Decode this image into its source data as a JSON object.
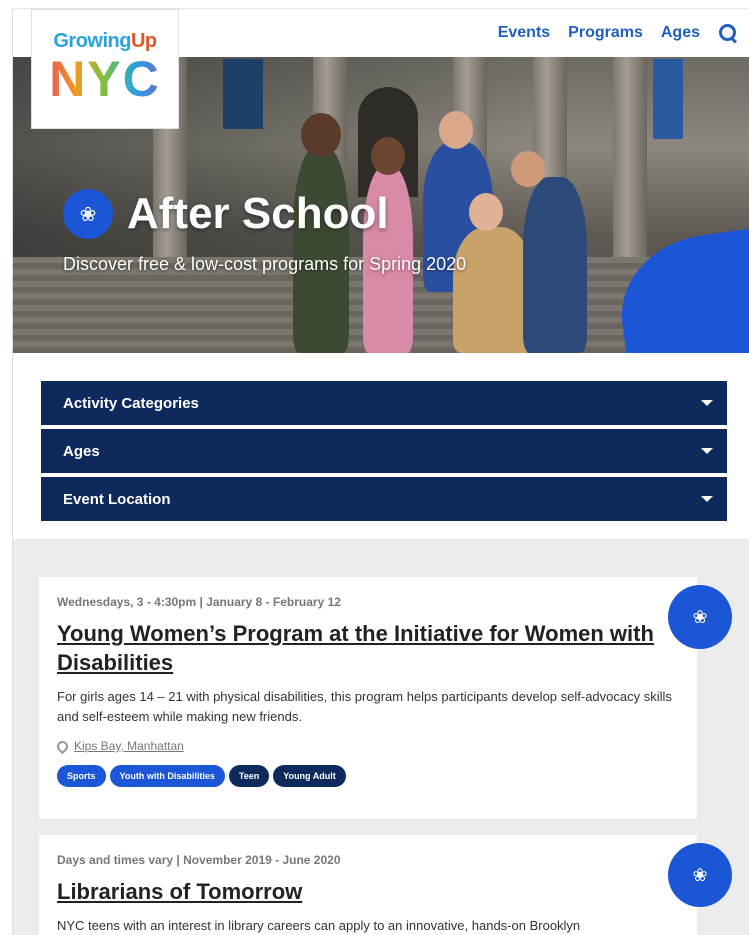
{
  "nav": {
    "events": "Events",
    "programs": "Programs",
    "ages": "Ages",
    "search_icon": "search-icon"
  },
  "logo": {
    "line1_a": "Growing",
    "line1_b": "Up",
    "line2": "NYC"
  },
  "hero": {
    "title": "After School",
    "subtitle": "Discover free & low-cost programs for Spring 2020",
    "icon": "activity-icon"
  },
  "filters": [
    "Activity Categories",
    "Ages",
    "Event Location"
  ],
  "programs": [
    {
      "meta": "Wednesdays, 3 - 4:30pm | January 8 - February 12",
      "title": "Young Women’s Program at the Initiative for Women with Disabilities",
      "desc": "For girls ages 14 – 21 with physical disabilities, this program helps participants develop self-advocacy skills and self-esteem while making new friends.",
      "location": "Kips Bay, Manhattan",
      "tags": [
        "Sports",
        "Youth with Disabilities",
        "Teen",
        "Young Adult"
      ]
    },
    {
      "meta": "Days and times vary | November 2019 - June 2020",
      "title": "Librarians of Tomorrow",
      "desc": "NYC teens with an interest in library careers can apply to an innovative, hands-on Brooklyn"
    }
  ],
  "colors": {
    "brand_blue": "#1a56d6",
    "navy": "#0e2a5c",
    "link": "#1f5fbf"
  }
}
